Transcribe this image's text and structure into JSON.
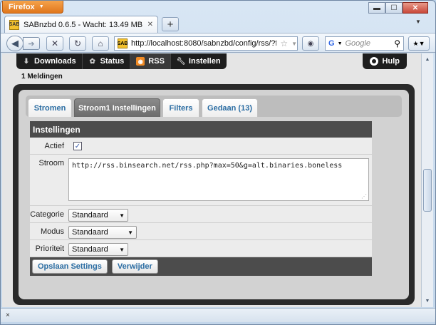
{
  "browser": {
    "menu_button": "Firefox",
    "tab_title": "SABnzbd 0.6.5 - Wacht: 13.49 MB",
    "favicon_text": "SAB",
    "url": "http://localhost:8080/sabnzbd/config/rss/?feed=",
    "search_placeholder": "Google",
    "status_close": "×"
  },
  "sab_menu": {
    "items": [
      {
        "label": "Downloads",
        "icon": "download-icon"
      },
      {
        "label": "Status",
        "icon": "status-icon"
      },
      {
        "label": "RSS",
        "icon": "rss-icon",
        "active": true
      },
      {
        "label": "Instellen",
        "icon": "wrench-icon"
      }
    ],
    "help_label": "Hulp"
  },
  "messages": "1 Meldingen",
  "tabs": [
    {
      "label": "Stromen"
    },
    {
      "label": "Stroom1 Instellingen",
      "active": true
    },
    {
      "label": "Filters"
    },
    {
      "label": "Gedaan (13)"
    }
  ],
  "form": {
    "header": "Instellingen",
    "active_label": "Actief",
    "active_checked": true,
    "feed_label": "Stroom",
    "feed_url": "http://rss.binsearch.net/rss.php?max=50&g=alt.binaries.boneless",
    "category_label": "Categorie",
    "category_value": "Standaard",
    "mode_label": "Modus",
    "mode_value": "Standaard",
    "priority_label": "Prioriteit",
    "priority_value": "Standaard",
    "save_button": "Opslaan Settings",
    "delete_button": "Verwijder"
  },
  "colors": {
    "accent_orange": "#e0761c",
    "link_blue": "#2b6da3",
    "dark_bar": "#1e1e1e"
  }
}
